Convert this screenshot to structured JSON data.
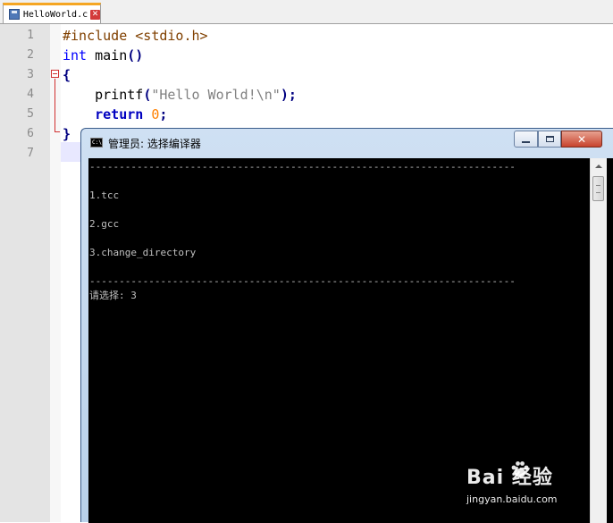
{
  "tab": {
    "label": "HelloWorld.c",
    "icon": "save-icon",
    "close_icon": "close-icon",
    "accent": "#f5a623"
  },
  "editor": {
    "line_numbers": [
      "1",
      "2",
      "3",
      "4",
      "5",
      "6",
      "7"
    ],
    "lines": [
      [
        {
          "t": "#include <stdio.h>",
          "c": "pp"
        }
      ],
      [
        {
          "t": "int",
          "c": "kw"
        },
        {
          "t": " main",
          "c": ""
        },
        {
          "t": "()",
          "c": "op"
        }
      ],
      [
        {
          "t": "{",
          "c": "op"
        }
      ],
      [
        {
          "t": "    printf",
          "c": ""
        },
        {
          "t": "(",
          "c": "op"
        },
        {
          "t": "\"Hello World!\\n\"",
          "c": "str"
        },
        {
          "t": ");",
          "c": "op"
        }
      ],
      [
        {
          "t": "    ",
          "c": ""
        },
        {
          "t": "return",
          "c": "kwb"
        },
        {
          "t": " ",
          "c": ""
        },
        {
          "t": "0",
          "c": "num"
        },
        {
          "t": ";",
          "c": "op"
        }
      ],
      [
        {
          "t": "}",
          "c": "op"
        }
      ],
      [
        {
          "t": "",
          "c": ""
        }
      ]
    ]
  },
  "console": {
    "title": "管理员: 选择编译器",
    "lines": [
      "------------------------------------------------------------------------",
      "",
      "1.tcc",
      "",
      "2.gcc",
      "",
      "3.change_directory",
      "",
      "------------------------------------------------------------------------",
      "请选择: 3"
    ],
    "buttons": {
      "minimize": "minimize-icon",
      "maximize": "maximize-icon",
      "close": "close-icon"
    }
  },
  "watermark": {
    "brand": "Bai  经验",
    "url": "jingyan.baidu.com"
  }
}
